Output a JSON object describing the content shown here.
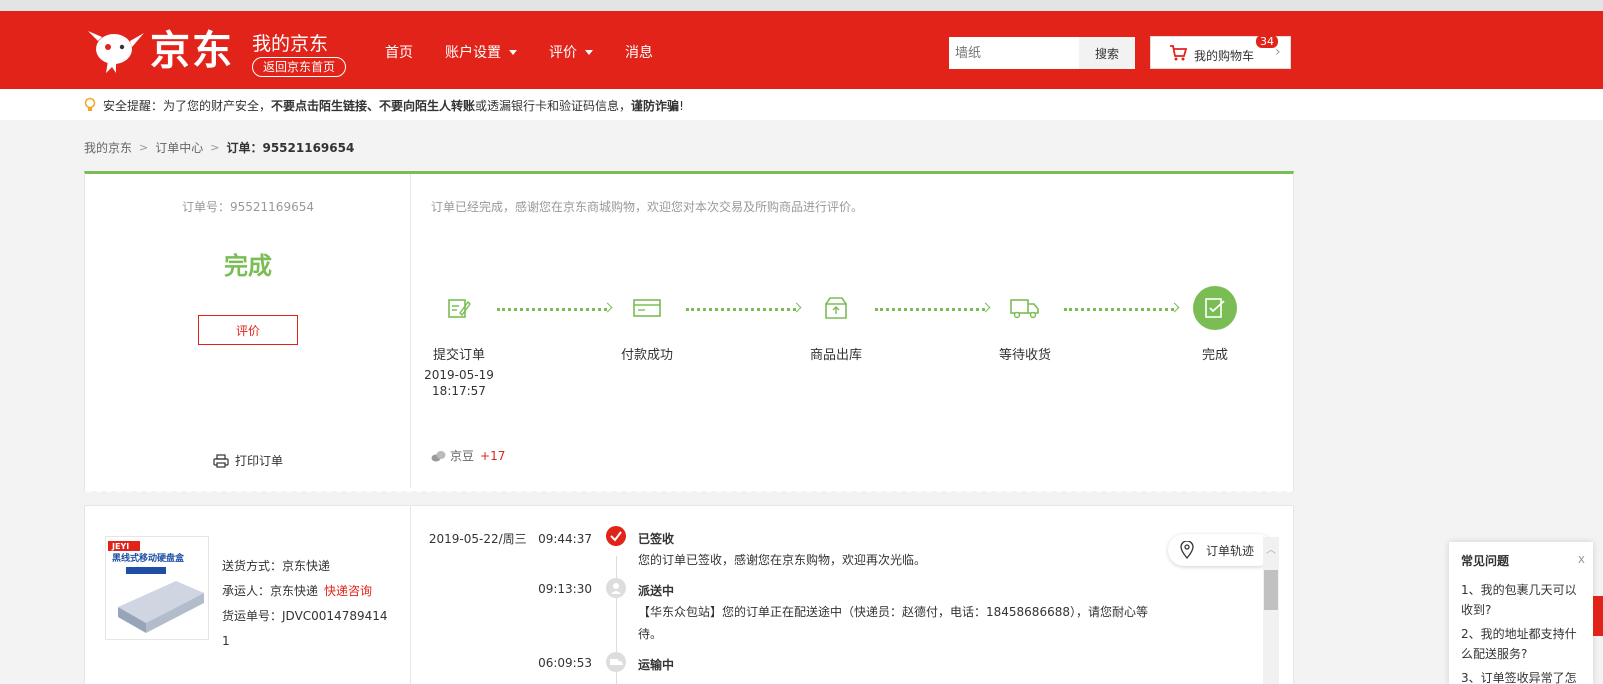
{
  "header": {
    "brand": "京东",
    "my_jd": "我的京东",
    "back_home": "返回京东首页",
    "nav": [
      {
        "label": "首页",
        "dropdown": false
      },
      {
        "label": "账户设置",
        "dropdown": true
      },
      {
        "label": "评价",
        "dropdown": true
      },
      {
        "label": "消息",
        "dropdown": false
      }
    ],
    "search_placeholder": "墙纸",
    "search_button": "搜索",
    "cart_label": "我的购物车",
    "cart_count": "34"
  },
  "notice": {
    "prefix": "安全提醒：为了您的财产安全，",
    "bold1": "不要点击陌生链接、不要向陌生人转账",
    "mid": "或透漏银行卡和验证码信息，",
    "bold2": "谨防诈骗",
    "suffix": "!"
  },
  "breadcrumb": {
    "items": [
      "我的京东",
      "订单中心"
    ],
    "current": "订单：95521169654"
  },
  "order": {
    "order_no_label": "订单号：95521169654",
    "status": "完成",
    "review_button": "评价",
    "print_label": "打印订单",
    "done_message": "订单已经完成，感谢您在京东商城购物，欢迎您对本次交易及所购商品进行评价。",
    "beans_label": "京豆",
    "beans_value": "+17",
    "steps": [
      {
        "label": "提交订单",
        "date": "2019-05-19",
        "time": "18:17:57",
        "icon": "submit-order-icon"
      },
      {
        "label": "付款成功",
        "date": "",
        "time": "",
        "icon": "payment-icon"
      },
      {
        "label": "商品出库",
        "date": "",
        "time": "",
        "icon": "outbound-box-icon"
      },
      {
        "label": "等待收货",
        "date": "",
        "time": "",
        "icon": "delivery-truck-icon"
      },
      {
        "label": "完成",
        "date": "",
        "time": "",
        "icon": "complete-check-icon"
      }
    ]
  },
  "shipping": {
    "product_brand": "JEYI",
    "product_caption": "黑线式移动硬盘盒",
    "method": "送货方式：京东快递",
    "carrier": "承运人：京东快递",
    "carrier_link": "快递咨询",
    "tracking_line1": "货运单号：JDVC0014789414",
    "tracking_line2": "1",
    "track_button": "订单轨迹"
  },
  "timeline": [
    {
      "date": "2019-05-22/周三",
      "time": "09:44:37",
      "title": "已签收",
      "desc": "您的订单已签收，感谢您在京东购物，欢迎再次光临。",
      "active": true
    },
    {
      "date": "",
      "time": "09:13:30",
      "title": "派送中",
      "desc": "【华东众包站】您的订单正在配送途中（快递员：赵德付，电话：18458686688），请您耐心等待。",
      "active": false
    },
    {
      "date": "",
      "time": "06:09:53",
      "title": "运输中",
      "desc": "",
      "active": false
    }
  ],
  "faq": {
    "title": "常见问题",
    "close": "x",
    "items": [
      "1、我的包裹几天可以收到?",
      "2、我的地址都支持什么配送服务?",
      "3、订单签收异常了怎"
    ]
  },
  "colors": {
    "brand_red": "#e2231a",
    "success_green": "#7abd54"
  }
}
